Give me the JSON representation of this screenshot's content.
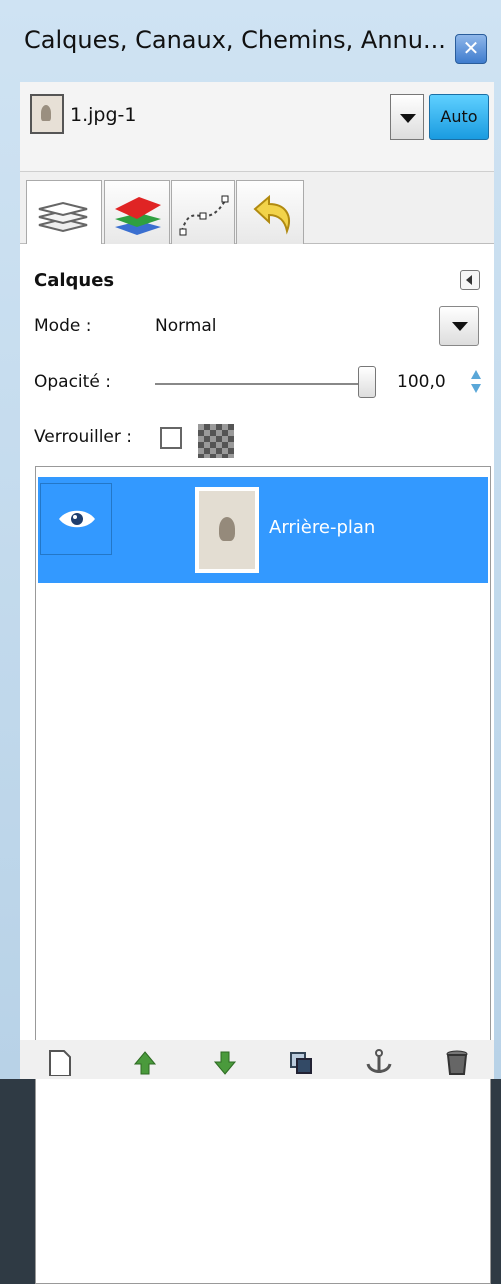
{
  "window": {
    "title": "Calques, Canaux, Chemins, Annu...",
    "close_label": "✕"
  },
  "image_selector": {
    "name": "1.jpg-1",
    "auto_label": "Auto"
  },
  "tabs": [
    {
      "icon": "layers-icon"
    },
    {
      "icon": "channels-icon"
    },
    {
      "icon": "paths-icon"
    },
    {
      "icon": "undo-history-icon"
    }
  ],
  "panel": {
    "title": "Calques",
    "mode_label": "Mode :",
    "mode_value": "Normal",
    "opacity_label": "Opacité :",
    "opacity_value": "100,0",
    "opacity_fraction": 1.0,
    "lock_label": "Verrouiller :"
  },
  "layers": [
    {
      "name": "Arrière-plan",
      "visible": true,
      "selected": true
    }
  ],
  "bottom_bar": [
    {
      "icon": "new-layer-icon"
    },
    {
      "icon": "raise-layer-icon"
    },
    {
      "icon": "lower-layer-icon"
    },
    {
      "icon": "duplicate-layer-icon"
    },
    {
      "icon": "anchor-layer-icon"
    },
    {
      "icon": "delete-layer-icon"
    }
  ],
  "colors": {
    "selection": "#3399ff",
    "auto_button": "#1a9be0",
    "titlebar": "#cfe3f3"
  }
}
